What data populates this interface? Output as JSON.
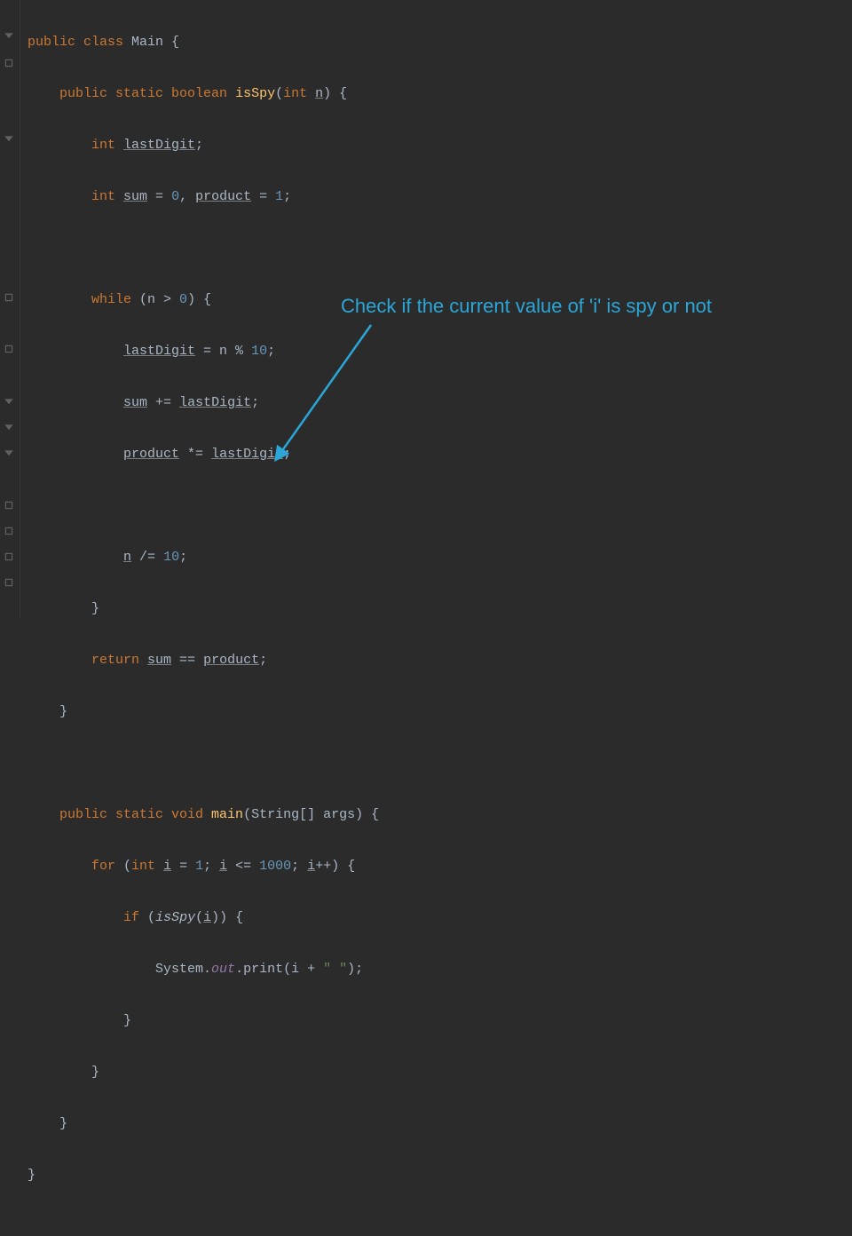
{
  "annotation": {
    "text": "Check if the current value of 'i' is spy or not"
  },
  "code": {
    "l1": {
      "a": "public class ",
      "b": "Main",
      "c": " {"
    },
    "l2": {
      "a": "    ",
      "b": "public static boolean ",
      "c": "isSpy",
      "d": "(",
      "e": "int ",
      "f": "n",
      "g": ") {"
    },
    "l3": {
      "a": "        ",
      "b": "int ",
      "c": "lastDigit",
      "d": ";"
    },
    "l4": {
      "a": "        ",
      "b": "int ",
      "c": "sum",
      "d": " = ",
      "e": "0",
      "f": ", ",
      "g": "product",
      "h": " = ",
      "i": "1",
      "j": ";"
    },
    "l5": "",
    "l6": {
      "a": "        ",
      "b": "while ",
      "c": "(n > ",
      "d": "0",
      "e": ") {"
    },
    "l7": {
      "a": "            ",
      "b": "lastDigit",
      "c": " = n % ",
      "d": "10",
      "e": ";"
    },
    "l8": {
      "a": "            ",
      "b": "sum",
      "c": " += ",
      "d": "lastDigit",
      "e": ";"
    },
    "l9": {
      "a": "            ",
      "b": "product",
      "c": " *= ",
      "d": "lastDigit",
      "e": ";"
    },
    "l10": "",
    "l11": {
      "a": "            ",
      "b": "n",
      "c": " /= ",
      "d": "10",
      "e": ";"
    },
    "l12": {
      "a": "        ",
      "b": "}"
    },
    "l13": {
      "a": "        ",
      "b": "return ",
      "c": "sum",
      "d": " == ",
      "e": "product",
      "f": ";"
    },
    "l14": {
      "a": "    ",
      "b": "}"
    },
    "l15": "",
    "l16": {
      "a": "    ",
      "b": "public static void ",
      "c": "main",
      "d": "(String[] args) {"
    },
    "l17": {
      "a": "        ",
      "b": "for ",
      "c": "(",
      "d": "int ",
      "e": "i",
      "f": " = ",
      "g": "1",
      "h": "; ",
      "i": "i",
      "j": " <= ",
      "k": "1000",
      "l": "; ",
      "m": "i",
      "n": "++) {"
    },
    "l18": {
      "a": "            ",
      "b": "if ",
      "c": "(",
      "d": "isSpy",
      "e": "(",
      "f": "i",
      "g": ")) {"
    },
    "l19": {
      "a": "                System.",
      "b": "out",
      "c": ".print(i + ",
      "d": "\" \"",
      "e": ");"
    },
    "l20": {
      "a": "            ",
      "b": "}"
    },
    "l21": {
      "a": "        ",
      "b": "}"
    },
    "l22": {
      "a": "    ",
      "b": "}"
    },
    "l23": {
      "a": "",
      "b": "}"
    }
  }
}
